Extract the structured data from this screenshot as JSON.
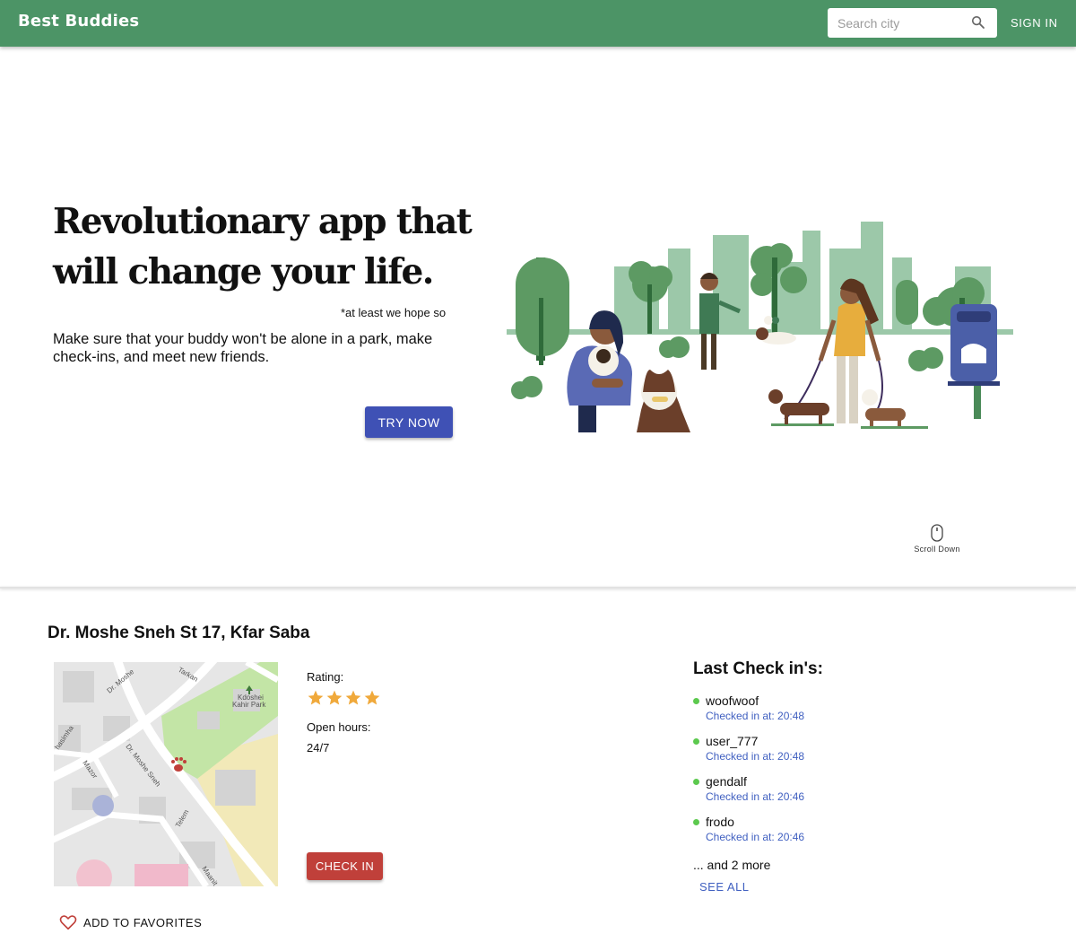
{
  "app": {
    "brand": "Best Buddies"
  },
  "header": {
    "search_placeholder": "Search city",
    "search_icon": "search-icon",
    "signin_label": "SIGN IN"
  },
  "hero": {
    "headline": "Revolutionary app that will change your life.",
    "footnote": "*at least we hope so",
    "subtext": "Make sure that your buddy won't be alone in a park, make check-ins, and meet new friends.",
    "cta_label": "TRY NOW",
    "scroll_label": "Scroll Down",
    "illustration": "people-walking-dogs-in-park-illustration"
  },
  "park": {
    "title": "Dr. Moshe Sneh St 17, Kfar Saba",
    "map_labels": {
      "park_name_1": "Kdoshei",
      "park_name_2": "Kahir Park",
      "street_1": "Dr. Moshe Sneh",
      "street_2": "Dr. Moshe",
      "street_3": "hasimha",
      "street_4": "Mazor",
      "street_5": "Telem",
      "street_6": "Maanit",
      "street_7": "Tarkan"
    },
    "rating_label": "Rating:",
    "rating": 4,
    "rating_max": 4,
    "hours_label": "Open hours:",
    "hours_value": "24/7",
    "checkin_label": "CHECK IN",
    "favorites_label": "ADD TO FAVORITES"
  },
  "checkins": {
    "title": "Last Check in's:",
    "items": [
      {
        "name": "woofwoof",
        "time": "Checked in at: 20:48"
      },
      {
        "name": "user_777",
        "time": "Checked in at: 20:48"
      },
      {
        "name": "gendalf",
        "time": "Checked in at: 20:46"
      },
      {
        "name": "frodo",
        "time": "Checked in at: 20:46"
      }
    ],
    "more_text": "... and 2 more",
    "see_all_label": "SEE ALL"
  },
  "colors": {
    "appbar": "#4c9466",
    "primary": "#3f51b5",
    "checkin": "#c0403a",
    "star": "#f0a93b",
    "online_dot": "#5cc94e",
    "link": "#3f5fc0"
  }
}
